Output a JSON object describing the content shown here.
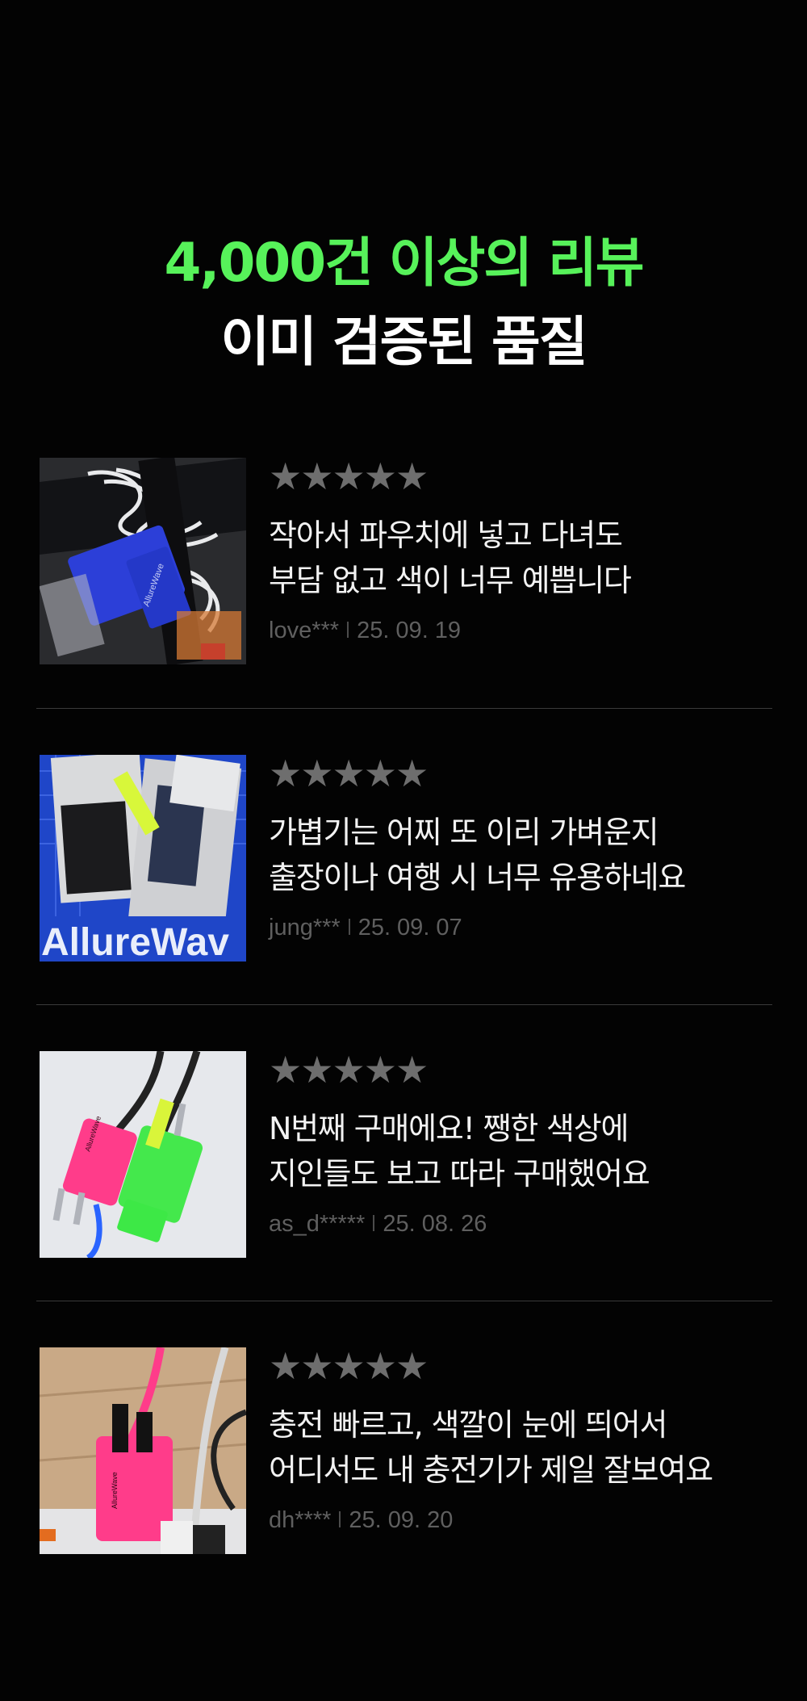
{
  "colors": {
    "background": "#030303",
    "accent": "#57f25a",
    "text": "#f2f2f2",
    "star": "#6e6e6e",
    "meta": "#5f5f5f",
    "divider": "#3a3a3a"
  },
  "hero": {
    "accent_line": "4,000건 이상의 리뷰",
    "main_line": "이미 검증된 품질"
  },
  "reviews": [
    {
      "stars": "★★★★★",
      "rating": 5,
      "lines": [
        "작아서 파우치에 넣고 다녀도",
        "부담 없고 색이 너무 예쁩니다"
      ],
      "author": "love***",
      "date": "25. 09. 19",
      "photo_brand_text": "AllureWave"
    },
    {
      "stars": "★★★★★",
      "rating": 5,
      "lines": [
        "가볍기는 어찌 또 이리 가벼운지",
        "출장이나 여행 시 너무 유용하네요"
      ],
      "author": "jung***",
      "date": "25. 09. 07",
      "photo_brand_text": "AllureWav"
    },
    {
      "stars": "★★★★★",
      "rating": 5,
      "lines": [
        "N번째 구매에요! 쨍한 색상에",
        "지인들도 보고 따라 구매했어요"
      ],
      "author": "as_d*****",
      "date": "25. 08. 26",
      "photo_brand_text": "AllureWave"
    },
    {
      "stars": "★★★★★",
      "rating": 5,
      "lines": [
        "충전 빠르고, 색깔이 눈에 띄어서",
        "어디서도 내 충전기가 제일 잘보여요"
      ],
      "author": "dh****",
      "date": "25. 09. 20",
      "photo_brand_text": "AllureWave"
    }
  ]
}
